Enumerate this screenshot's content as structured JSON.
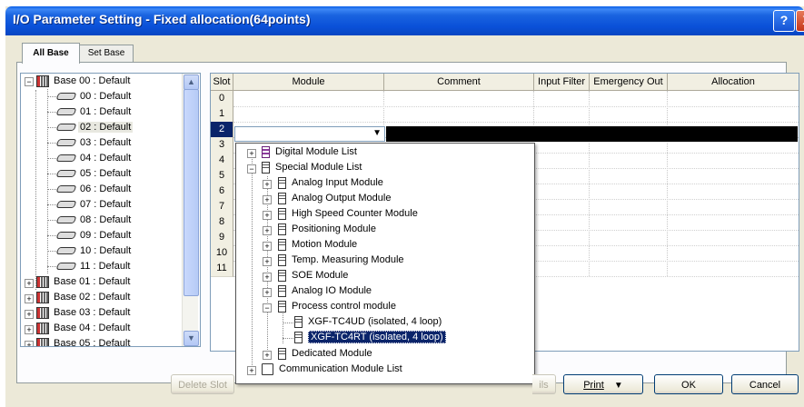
{
  "window": {
    "title": "I/O Parameter Setting - Fixed allocation(64points)",
    "help_glyph": "?",
    "close_glyph": "X"
  },
  "tabs": [
    {
      "label": "All Base"
    },
    {
      "label": "Set Base"
    }
  ],
  "tree": {
    "base00": "Base 00 : Default",
    "slots": [
      "00 : Default",
      "01 : Default",
      "02 : Default",
      "03 : Default",
      "04 : Default",
      "05 : Default",
      "06 : Default",
      "07 : Default",
      "08 : Default",
      "09 : Default",
      "10 : Default",
      "11 : Default"
    ],
    "other_bases": [
      "Base 01 : Default",
      "Base 02 : Default",
      "Base 03 : Default",
      "Base 04 : Default",
      "Base 05 : Default"
    ]
  },
  "grid": {
    "headers": [
      "Slot",
      "Module",
      "Comment",
      "Input Filter",
      "Emergency Out",
      "Allocation"
    ],
    "rows": [
      "0",
      "1",
      "2",
      "3",
      "4",
      "5",
      "6",
      "7",
      "8",
      "9",
      "10",
      "11"
    ],
    "selected_row": "2"
  },
  "popup": {
    "digital": "Digital Module List",
    "special": "Special Module List",
    "items": [
      "Analog Input Module",
      "Analog Output Module",
      "High Speed Counter Module",
      "Positioning Module",
      "Motion Module",
      "Temp. Measuring Module",
      "SOE Module",
      "Analog IO Module",
      "Process control module"
    ],
    "process_children": [
      "XGF-TC4UD (isolated, 4 loop)",
      "XGF-TC4RT (isolated, 4 loop)"
    ],
    "dedicated": "Dedicated Module",
    "communication": "Communication Module List"
  },
  "buttons": {
    "delete_slot": "Delete Slot",
    "details": "ils",
    "print": "Print",
    "print_arrow": "▼",
    "ok": "OK",
    "cancel": "Cancel"
  },
  "icons": {
    "expand_plus": "+",
    "expand_minus": "−",
    "dropdown_arrow": "▼",
    "scroll_up": "▲",
    "scroll_down": "▼"
  }
}
